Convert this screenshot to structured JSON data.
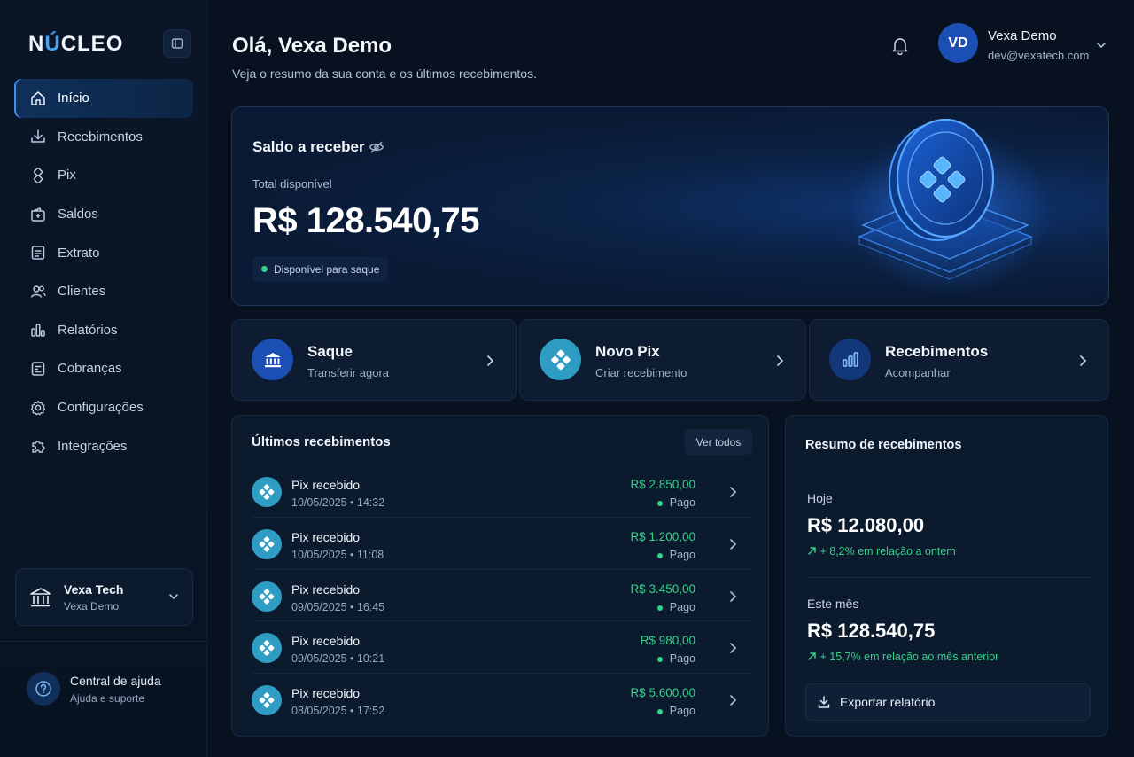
{
  "brand": {
    "logo_prefix": "N",
    "logo_accent": "Ú",
    "logo_suffix": "CLEO"
  },
  "sidebar": {
    "items": [
      {
        "label": "Início",
        "icon": "home-icon",
        "active": true
      },
      {
        "label": "Recebimentos",
        "icon": "download-tray-icon"
      },
      {
        "label": "Pix",
        "icon": "pix-icon"
      },
      {
        "label": "Saldos",
        "icon": "wallet-icon"
      },
      {
        "label": "Extrato",
        "icon": "document-icon"
      },
      {
        "label": "Clientes",
        "icon": "users-icon"
      },
      {
        "label": "Relatórios",
        "icon": "bar-chart-icon"
      },
      {
        "label": "Cobranças",
        "icon": "invoice-icon"
      },
      {
        "label": "Configurações",
        "icon": "gear-icon"
      },
      {
        "label": "Integrações",
        "icon": "puzzle-icon"
      }
    ],
    "company": {
      "name": "Vexa Tech",
      "user": "Vexa Demo"
    },
    "help": {
      "title": "Central de ajuda",
      "subtitle": "Ajuda e suporte"
    }
  },
  "header": {
    "greeting": "Olá, Vexa Demo",
    "subtitle": "Veja o resumo da sua conta e os últimos recebimentos.",
    "user": {
      "initials": "VD",
      "name": "Vexa Demo",
      "email": "dev@vexatech.com"
    }
  },
  "balance": {
    "title": "Saldo a receber",
    "label": "Total disponível",
    "value": "R$ 128.540,75",
    "badge": "Disponível para saque"
  },
  "actions": [
    {
      "title": "Saque",
      "subtitle": "Transferir agora",
      "icon": "bank-icon"
    },
    {
      "title": "Novo Pix",
      "subtitle": "Criar recebimento",
      "icon": "pix-icon"
    },
    {
      "title": "Recebimentos",
      "subtitle": "Acompanhar",
      "icon": "bar-chart-icon"
    }
  ],
  "recent": {
    "title": "Últimos recebimentos",
    "view_all": "Ver todos",
    "rows": [
      {
        "title": "Pix recebido",
        "date": "10/05/2025 • 14:32",
        "amount": "R$ 2.850,00",
        "status": "Pago"
      },
      {
        "title": "Pix recebido",
        "date": "10/05/2025 • 11:08",
        "amount": "R$ 1.200,00",
        "status": "Pago"
      },
      {
        "title": "Pix recebido",
        "date": "09/05/2025 • 16:45",
        "amount": "R$ 3.450,00",
        "status": "Pago"
      },
      {
        "title": "Pix recebido",
        "date": "09/05/2025 • 10:21",
        "amount": "R$ 980,00",
        "status": "Pago"
      },
      {
        "title": "Pix recebido",
        "date": "08/05/2025 • 17:52",
        "amount": "R$ 5.600,00",
        "status": "Pago"
      }
    ]
  },
  "summary": {
    "title": "Resumo de recebimentos",
    "today_label": "Hoje",
    "today_value": "R$ 12.080,00",
    "today_change": "+ 8,2% em relação a ontem",
    "month_label": "Este mês",
    "month_value": "R$ 128.540,75",
    "month_change": "+ 15,7% em relação ao mês anterior",
    "export_label": "Exportar relatório"
  },
  "colors": {
    "accent": "#3f8ef0",
    "positive": "#35d08a",
    "pix": "#2f9cc4"
  }
}
